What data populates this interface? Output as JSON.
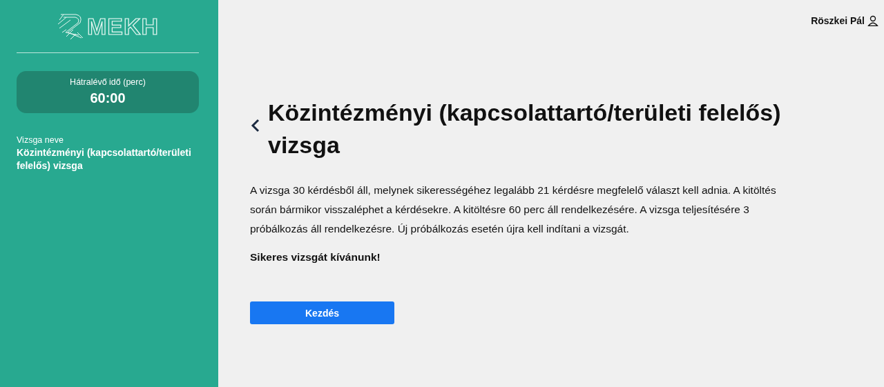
{
  "sidebar": {
    "logo": "MEKH",
    "timer": {
      "label": "Hátralévő idő (perc)",
      "value": "60:00"
    },
    "exam_name_label": "Vizsga neve",
    "exam_name": "Közintézményi (kapcsolattartó/területi felelős) vizsga"
  },
  "header": {
    "user": "Röszkei Pál"
  },
  "main": {
    "title": "Közintézményi (kapcsolattartó/területi felelős) vizsga",
    "description": "A vizsga 30 kérdésből áll, melynek sikerességéhez legalább 21 kérdésre megfelelő választ kell adnia. A kitöltés során bármikor visszaléphet a kérdésekre. A kitöltésre 60 perc áll rendelkezésére. A vizsga teljesítésére 3 próbálkozás áll rendelkezésre. Új próbálkozás esetén újra kell indítani a vizsgát.",
    "wish": "Sikeres vizsgát kívánunk!",
    "start_button": "Kezdés"
  }
}
